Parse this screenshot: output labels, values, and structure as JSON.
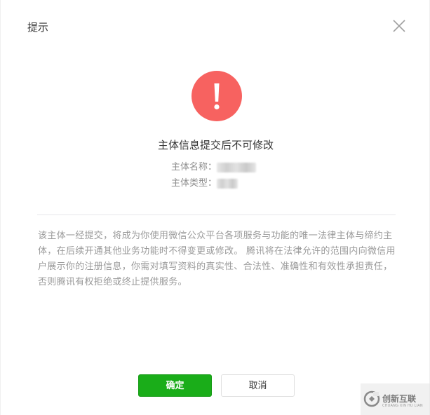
{
  "dialog": {
    "title": "提示",
    "close_icon": "close-icon",
    "alert_icon": "exclamation-circle-icon",
    "alert_color": "#f76260",
    "main_title": "主体信息提交后不可修改",
    "info": {
      "name_label": "主体名称：",
      "type_label": "主体类型："
    },
    "notice": "该主体一经提交，将成为你使用微信公众平台各项服务与功能的唯一法律主体与缔约主体，在后续开通其他业务功能时不得变更或修改。 腾讯将在法律允许的范围内向微信用户展示你的注册信息，你需对填写资料的真实性、合法性、准确性和有效性承担责任，否则腾讯有权拒绝或终止提供服务。",
    "buttons": {
      "confirm": "确定",
      "cancel": "取消"
    },
    "confirm_color": "#1aad19"
  },
  "watermark": {
    "text": "创新互联",
    "subtext": "CHUANG XIN HU LIAN"
  }
}
